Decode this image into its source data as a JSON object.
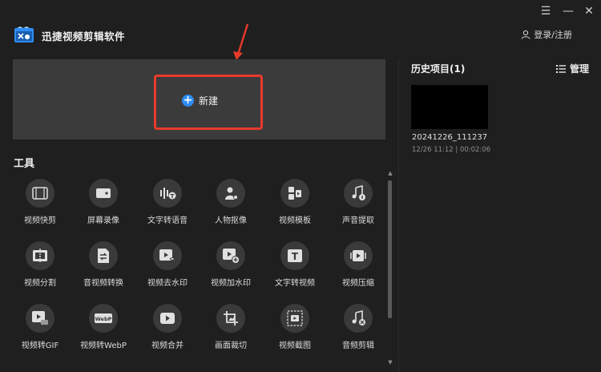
{
  "app": {
    "title": "迅捷视频剪辑软件"
  },
  "window": {
    "menu_icon": "hamburger-icon",
    "minimize_icon": "minimize-icon",
    "close_icon": "close-icon"
  },
  "header": {
    "login_label": "登录/注册"
  },
  "new_project": {
    "label": "新建"
  },
  "tools": {
    "title": "工具",
    "items": [
      {
        "label": "视频快剪",
        "icon": "film-icon"
      },
      {
        "label": "屏幕录像",
        "icon": "screen-record-icon"
      },
      {
        "label": "文字转语音",
        "icon": "text-to-speech-icon"
      },
      {
        "label": "人物抠像",
        "icon": "person-cutout-icon"
      },
      {
        "label": "视频模板",
        "icon": "template-icon"
      },
      {
        "label": "声音提取",
        "icon": "audio-extract-icon"
      },
      {
        "label": "视频分割",
        "icon": "split-icon"
      },
      {
        "label": "音视频转换",
        "icon": "convert-icon"
      },
      {
        "label": "视频去水印",
        "icon": "remove-watermark-icon"
      },
      {
        "label": "视频加水印",
        "icon": "add-watermark-icon"
      },
      {
        "label": "文字转视频",
        "icon": "text-to-video-icon"
      },
      {
        "label": "视频压缩",
        "icon": "compress-icon"
      },
      {
        "label": "视频转GIF",
        "icon": "gif-icon"
      },
      {
        "label": "视频转WebP",
        "icon": "webp-icon"
      },
      {
        "label": "视频合并",
        "icon": "merge-icon"
      },
      {
        "label": "画面裁切",
        "icon": "crop-icon"
      },
      {
        "label": "视频截图",
        "icon": "screenshot-icon"
      },
      {
        "label": "音频剪辑",
        "icon": "audio-edit-icon"
      }
    ]
  },
  "history": {
    "title": "历史项目(1)",
    "manage_label": "管理",
    "projects": [
      {
        "name": "20241226_111237",
        "meta": "12/26 11:12 | 00:02:06"
      }
    ]
  },
  "colors": {
    "accent": "#2f8cf5",
    "highlight": "#e83a2c",
    "panel": "#3b3b3b",
    "background": "#1f1f1f"
  }
}
